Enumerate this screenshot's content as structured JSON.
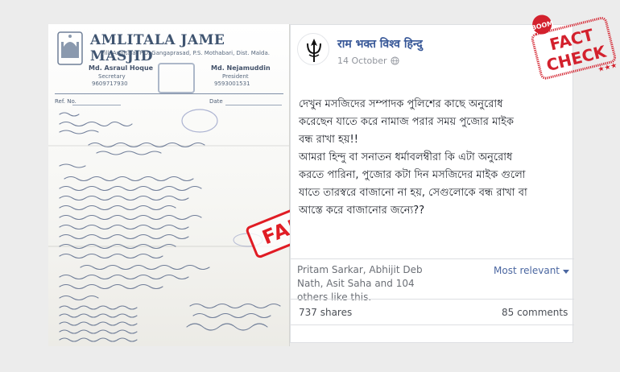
{
  "letter": {
    "letterhead_title": "AMLITALA JAME MASJID",
    "address": "Vill. Amlitala, P.O. Gangaprasad, P.S. Mothabari, Dist. Malda.",
    "secretary_name": "Md. Asraul Hoque",
    "secretary_role": "Secretary",
    "secretary_phone": "9609717930",
    "president_name": "Md. Nejamuddin",
    "president_role": "President",
    "president_phone": "9593001531",
    "ref_label": "Ref. No.",
    "date_label": "Date",
    "fake_label": "FAKE"
  },
  "post": {
    "page_name": "राम भक्त विश्व हिन्दु",
    "date": "14 October",
    "body": "দেখুন মসজিদের সম্পাদক পুলিশের কাছে অনুরোধ\nকরেছেন যাতে করে নামাজ পরার সময় পুজোর মাইক\nবন্ধ রাখা হয়!!\nআমরা হিন্দু বা সনাতন ধর্মাবলম্বীরা কি এটা অনুরোধ\nকরতে পারিনা, পুজোর কটা দিন মসজিদের মাইক গুলো\nযাতে তারস্বরে বাজানো না হয়, সেগুলোকে বন্ধ রাখা বা\nআস্তে করে বাজানোর জন্যে??",
    "likes_text": "Pritam Sarkar, Abhijit Deb Nath, Asit Saha and 104 others like this.",
    "sort_label": "Most relevant",
    "shares": "737 shares",
    "comments": "85 comments"
  },
  "badge": {
    "brand": "BOOM",
    "line1": "FACT",
    "line2": "CHECK"
  },
  "colors": {
    "fake_red": "#e01c24",
    "fb_link": "#385898",
    "stamp_red": "#d3212d"
  }
}
